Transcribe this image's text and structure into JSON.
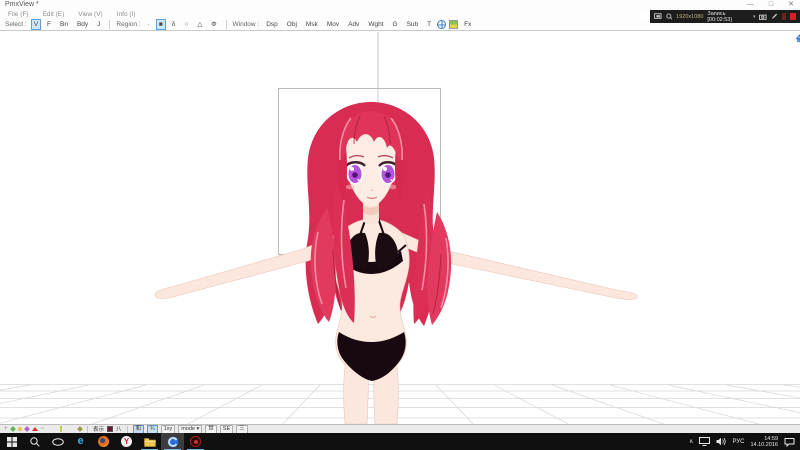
{
  "window": {
    "title": "PmxView *",
    "minimize": "—",
    "maximize": "□",
    "close": "✕"
  },
  "recorder": {
    "resolution": "1920x1080",
    "status": "Запись [00:02:53]",
    "caret": "▾"
  },
  "menu": {
    "items": [
      "File (F)",
      "Edit (E)",
      "View (V)",
      "Info (I)"
    ]
  },
  "toolbar": {
    "select_label": "Select :",
    "select_buttons": [
      "V",
      "F",
      "Bn",
      "Bdy",
      "J"
    ],
    "region_label": "Region :",
    "region_buttons": [
      "·",
      "■",
      "δ",
      "○",
      "△",
      "Φ"
    ],
    "window_label": "Window :",
    "window_buttons": [
      "Dsp",
      "Obj",
      "Msk",
      "Mov",
      "Adv",
      "Wght",
      "G",
      "Sub",
      "T"
    ],
    "fx_label": "Fx"
  },
  "statusbar": {
    "display_label": "表示",
    "glyph_label": "八",
    "toggle_buttons": [
      "和",
      "¾",
      "1xy"
    ],
    "mode_button": "mode ▾",
    "right_buttons": [
      "世",
      "SE",
      "三"
    ]
  },
  "taskbar": {
    "edge_glyph": "e",
    "yandex_glyph": "Y",
    "tray": {
      "chevron": "∧",
      "lang": "РУС",
      "time": "14:59",
      "date": "14.10.2016"
    }
  },
  "colors": {
    "hair": "#dd2f56",
    "eyes": "#b653dd",
    "bikini": "#17090f",
    "accent": "#5aa0dc"
  }
}
